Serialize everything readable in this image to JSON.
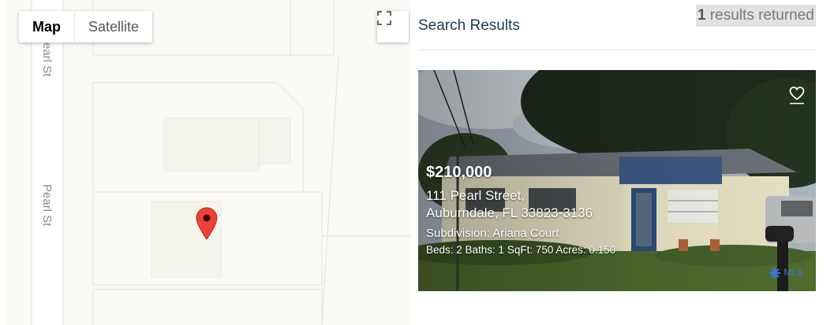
{
  "map": {
    "type_buttons": [
      {
        "label": "Map",
        "active": true
      },
      {
        "label": "Satellite",
        "active": false
      }
    ],
    "street_labels": [
      "Pearl St",
      "Pearl St"
    ],
    "marker_color": "#ea4335",
    "fullscreen_icon": "fullscreen-icon"
  },
  "results": {
    "title": "Search Results",
    "count": "1",
    "count_suffix": " results returned"
  },
  "listing": {
    "price": "$210,000",
    "address_line1": "111 Pearl Street,",
    "address_line2": "Auburndale, FL 33823-3136",
    "subdivision": "Subdivision: Ariana Court",
    "specs": "Beds: 2  Baths: 1  SqFt: 750  Acres: 0.150",
    "favorite_icon": "heart-icon",
    "mls_logo": "Stellar MLS",
    "mls_logo_text": "MLS"
  }
}
